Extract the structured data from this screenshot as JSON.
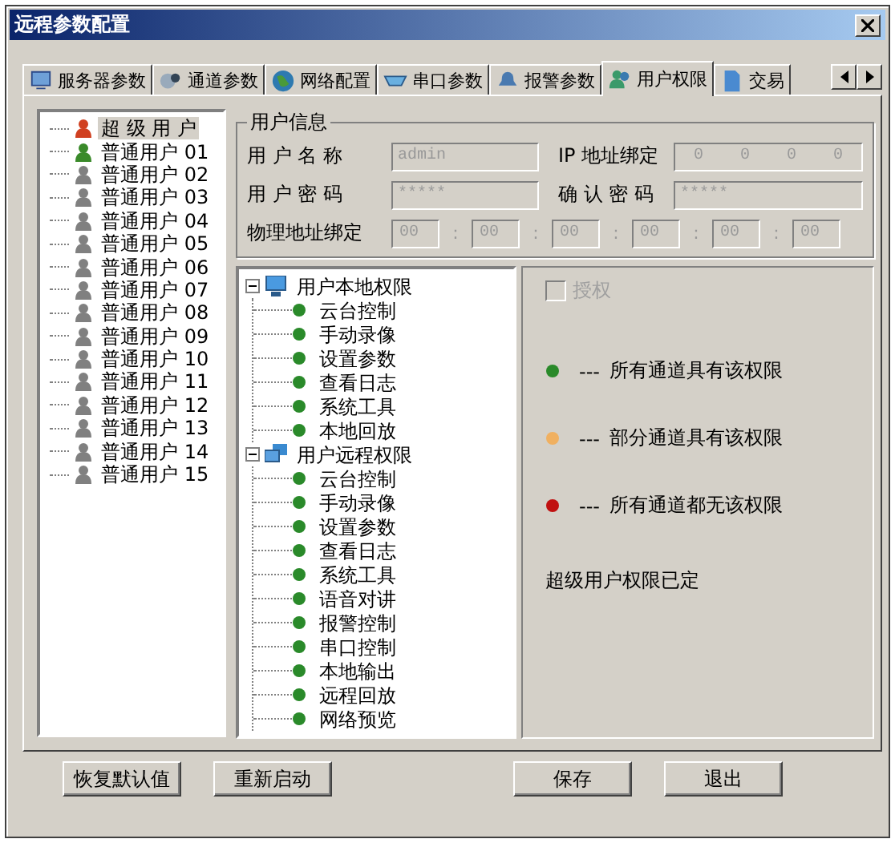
{
  "window": {
    "title": "远程参数配置"
  },
  "tabs": [
    {
      "label": "服务器参数",
      "selected": false
    },
    {
      "label": "通道参数",
      "selected": false
    },
    {
      "label": "网络配置",
      "selected": false
    },
    {
      "label": "串口参数",
      "selected": false
    },
    {
      "label": "报警参数",
      "selected": false
    },
    {
      "label": "用户权限",
      "selected": true
    },
    {
      "label": "交易",
      "selected": false
    }
  ],
  "users": [
    {
      "label": "超 级 用 户",
      "color": "#d04020",
      "selected": true
    },
    {
      "label": "普通用户 01",
      "color": "#3a8a2a",
      "selected": false
    },
    {
      "label": "普通用户 02",
      "color": "#808080",
      "selected": false
    },
    {
      "label": "普通用户 03",
      "color": "#808080",
      "selected": false
    },
    {
      "label": "普通用户 04",
      "color": "#808080",
      "selected": false
    },
    {
      "label": "普通用户 05",
      "color": "#808080",
      "selected": false
    },
    {
      "label": "普通用户 06",
      "color": "#808080",
      "selected": false
    },
    {
      "label": "普通用户 07",
      "color": "#808080",
      "selected": false
    },
    {
      "label": "普通用户 08",
      "color": "#808080",
      "selected": false
    },
    {
      "label": "普通用户 09",
      "color": "#808080",
      "selected": false
    },
    {
      "label": "普通用户 10",
      "color": "#808080",
      "selected": false
    },
    {
      "label": "普通用户 11",
      "color": "#808080",
      "selected": false
    },
    {
      "label": "普通用户 12",
      "color": "#808080",
      "selected": false
    },
    {
      "label": "普通用户 13",
      "color": "#808080",
      "selected": false
    },
    {
      "label": "普通用户 14",
      "color": "#808080",
      "selected": false
    },
    {
      "label": "普通用户 15",
      "color": "#808080",
      "selected": false
    }
  ],
  "user_info": {
    "title": "用户信息",
    "name": {
      "label": "用 户 名 称",
      "value": "admin"
    },
    "ip": {
      "label": "IP 地址绑定",
      "parts": [
        "0",
        "0",
        "0",
        "0"
      ]
    },
    "password": {
      "label": "用 户 密 码",
      "value": "*****"
    },
    "confirm": {
      "label": "确 认 密 码",
      "value": "*****"
    },
    "mac": {
      "label": "物理地址绑定",
      "separator": ":",
      "parts": [
        "00",
        "00",
        "00",
        "00",
        "00",
        "00"
      ]
    }
  },
  "permissions": [
    {
      "label": "用户本地权限",
      "expanded": true,
      "children": [
        {
          "label": "云台控制",
          "color": "#2a8a2a"
        },
        {
          "label": "手动录像",
          "color": "#2a8a2a"
        },
        {
          "label": "设置参数",
          "color": "#2a8a2a"
        },
        {
          "label": "查看日志",
          "color": "#2a8a2a"
        },
        {
          "label": "系统工具",
          "color": "#2a8a2a"
        },
        {
          "label": "本地回放",
          "color": "#2a8a2a"
        }
      ]
    },
    {
      "label": "用户远程权限",
      "expanded": true,
      "children": [
        {
          "label": "云台控制",
          "color": "#2a8a2a"
        },
        {
          "label": "手动录像",
          "color": "#2a8a2a"
        },
        {
          "label": "设置参数",
          "color": "#2a8a2a"
        },
        {
          "label": "查看日志",
          "color": "#2a8a2a"
        },
        {
          "label": "系统工具",
          "color": "#2a8a2a"
        },
        {
          "label": "语音对讲",
          "color": "#2a8a2a"
        },
        {
          "label": "报警控制",
          "color": "#2a8a2a"
        },
        {
          "label": "串口控制",
          "color": "#2a8a2a"
        },
        {
          "label": "本地输出",
          "color": "#2a8a2a"
        },
        {
          "label": "远程回放",
          "color": "#2a8a2a"
        },
        {
          "label": "网络预览",
          "color": "#2a8a2a"
        }
      ]
    }
  ],
  "authorize": {
    "label": "授权",
    "checked": false,
    "disabled": true
  },
  "legend": [
    {
      "dash": "---",
      "text": "所有通道具有该权限",
      "color": "#2a8a2a"
    },
    {
      "dash": "---",
      "text": "部分通道具有该权限",
      "color": "#f0b060"
    },
    {
      "dash": "---",
      "text": "所有通道都无该权限",
      "color": "#c01010"
    }
  ],
  "note": "超级用户权限已定",
  "buttons": {
    "left": [
      "恢复默认值",
      "重新启动"
    ],
    "right": [
      "保存",
      "退出"
    ]
  }
}
